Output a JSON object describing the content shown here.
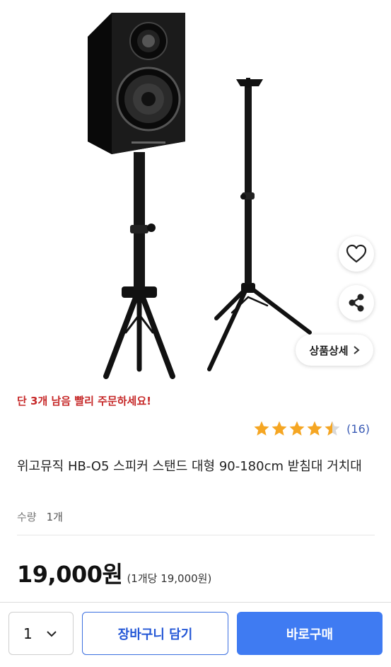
{
  "product": {
    "image_alt": "speaker-stand-photo",
    "stock_notice": "단 3개 남음 빨리 주문하세요!",
    "rating": 4.5,
    "review_count": "(16)",
    "title": "위고뮤직 HB-O5 스피커 스탠드 대형 90-180cm 받침대 거치대",
    "quantity_label": "수량",
    "quantity_value": "1개",
    "price": "19,000원",
    "unit_price": "(1개당 19,000원)"
  },
  "actions": {
    "detail_label": "상품상세",
    "wish_icon": "heart-icon",
    "share_icon": "share-icon"
  },
  "bottom_bar": {
    "quantity_selected": "1",
    "cart_label": "장바구니 담기",
    "buy_label": "바로구매"
  },
  "colors": {
    "star": "#f5a623",
    "stock_notice": "#c62828",
    "buy_button": "#3f7bf2",
    "cart_border": "#3b6fe0",
    "review_count": "#3a5bb5"
  }
}
